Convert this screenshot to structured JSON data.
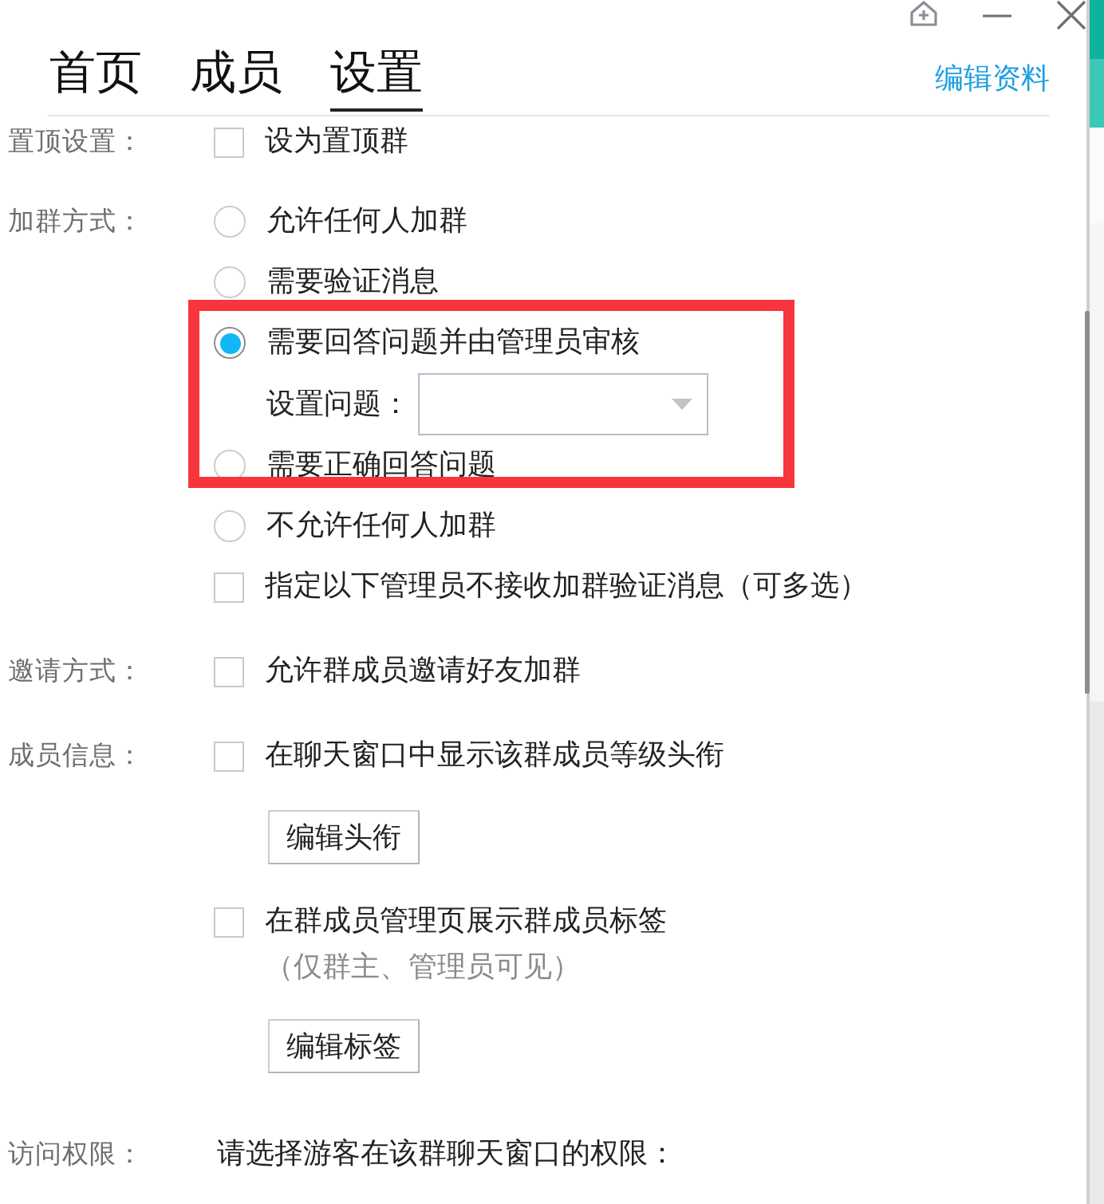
{
  "tabs": [
    {
      "label": "首页",
      "selected": false
    },
    {
      "label": "成员",
      "selected": false
    },
    {
      "label": "设置",
      "selected": true
    }
  ],
  "edit_profile_link": "编辑资料",
  "sections": [
    {
      "label": "置顶设置：",
      "items": [
        {
          "kind": "checkbox",
          "label": "设为置顶群",
          "checked": false
        }
      ]
    },
    {
      "label": "加群方式：",
      "items": [
        {
          "kind": "radio",
          "label": "允许任何人加群",
          "selected": false
        },
        {
          "kind": "radio",
          "label": "需要验证消息",
          "selected": false
        },
        {
          "kind": "radio",
          "label": "需要回答问题并由管理员审核",
          "selected": true
        },
        {
          "kind": "select",
          "label": "设置问题："
        },
        {
          "kind": "radio",
          "label": "需要正确回答问题",
          "selected": false
        },
        {
          "kind": "radio",
          "label": "不允许任何人加群",
          "selected": false
        },
        {
          "kind": "checkbox",
          "label": "指定以下管理员不接收加群验证消息（可多选）",
          "checked": false
        }
      ]
    },
    {
      "label": "邀请方式：",
      "items": [
        {
          "kind": "checkbox",
          "label": "允许群成员邀请好友加群",
          "checked": false
        }
      ]
    },
    {
      "label": "成员信息：",
      "items": [
        {
          "kind": "checkbox",
          "label": "在聊天窗口中显示该群成员等级头衔",
          "checked": false
        },
        {
          "kind": "button",
          "label": "编辑头衔"
        },
        {
          "kind": "checkbox",
          "label": "在群成员管理页展示群成员标签",
          "checked": false
        },
        {
          "kind": "note",
          "text": "（仅群主、管理员可见）"
        },
        {
          "kind": "button",
          "label": "编辑标签"
        }
      ]
    },
    {
      "label": "访问权限：",
      "items": [
        {
          "kind": "text",
          "text": "请选择游客在该群聊天窗口的权限："
        }
      ]
    }
  ],
  "annotations": [
    {
      "kind": "frame"
    }
  ]
}
